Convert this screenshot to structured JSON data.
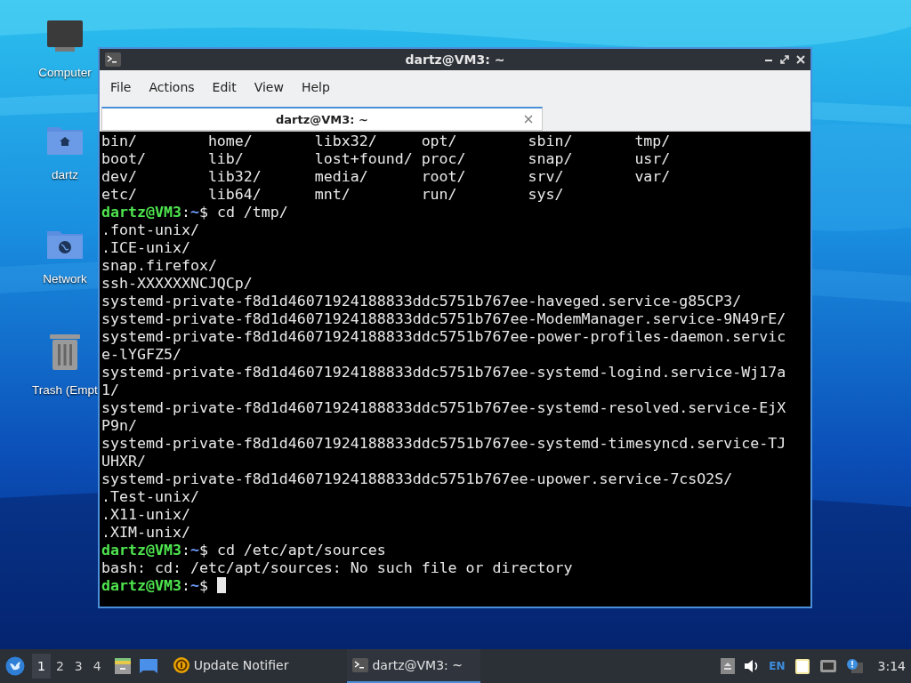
{
  "desktop": {
    "icons": [
      {
        "kind": "computer",
        "label": "Computer"
      },
      {
        "kind": "home",
        "label": "dartz"
      },
      {
        "kind": "network",
        "label": "Network"
      },
      {
        "kind": "trash",
        "label": "Trash (Empt"
      }
    ]
  },
  "window": {
    "title": "dartz@VM3: ~",
    "menu": [
      "File",
      "Actions",
      "Edit",
      "View",
      "Help"
    ],
    "tabs": [
      {
        "label": "dartz@VM3: ~",
        "selected": true
      }
    ],
    "terminal": {
      "lines": [
        {
          "kind": "columns",
          "cells": [
            "bin/",
            "home/",
            "libx32/",
            "opt/",
            "sbin/",
            "tmp/"
          ]
        },
        {
          "kind": "columns",
          "cells": [
            "boot/",
            "lib/",
            "lost+found/",
            "proc/",
            "snap/",
            "usr/"
          ]
        },
        {
          "kind": "columns",
          "cells": [
            "dev/",
            "lib32/",
            "media/",
            "root/",
            "srv/",
            "var/"
          ]
        },
        {
          "kind": "columns",
          "cells": [
            "etc/",
            "lib64/",
            "mnt/",
            "run/",
            "sys/"
          ]
        },
        {
          "kind": "prompt",
          "user": "dartz@VM3",
          "separator": ":",
          "path": "~",
          "command": "$ cd /tmp/",
          "cursor": false
        },
        {
          "kind": "output",
          "text": ".font-unix/"
        },
        {
          "kind": "output",
          "text": ".ICE-unix/"
        },
        {
          "kind": "output",
          "text": "snap.firefox/"
        },
        {
          "kind": "output",
          "text": "ssh-XXXXXXNCJQCp/"
        },
        {
          "kind": "output",
          "text": "systemd-private-f8d1d46071924188833ddc5751b767ee-haveged.service-g85CP3/"
        },
        {
          "kind": "output",
          "text": "systemd-private-f8d1d46071924188833ddc5751b767ee-ModemManager.service-9N49rE/"
        },
        {
          "kind": "output",
          "text": "systemd-private-f8d1d46071924188833ddc5751b767ee-power-profiles-daemon.servic"
        },
        {
          "kind": "output",
          "text": "e-lYGFZ5/"
        },
        {
          "kind": "output",
          "text": "systemd-private-f8d1d46071924188833ddc5751b767ee-systemd-logind.service-Wj17a"
        },
        {
          "kind": "output",
          "text": "1/"
        },
        {
          "kind": "output",
          "text": "systemd-private-f8d1d46071924188833ddc5751b767ee-systemd-resolved.service-EjX"
        },
        {
          "kind": "output",
          "text": "P9n/"
        },
        {
          "kind": "output",
          "text": "systemd-private-f8d1d46071924188833ddc5751b767ee-systemd-timesyncd.service-TJ"
        },
        {
          "kind": "output",
          "text": "UHXR/"
        },
        {
          "kind": "output",
          "text": "systemd-private-f8d1d46071924188833ddc5751b767ee-upower.service-7csO2S/"
        },
        {
          "kind": "output",
          "text": ".Test-unix/"
        },
        {
          "kind": "output",
          "text": ".X11-unix/"
        },
        {
          "kind": "output",
          "text": ".XIM-unix/"
        },
        {
          "kind": "prompt",
          "user": "dartz@VM3",
          "separator": ":",
          "path": "~",
          "command": "$ cd /etc/apt/sources",
          "cursor": false
        },
        {
          "kind": "output",
          "text": "bash: cd: /etc/apt/sources: No such file or directory"
        },
        {
          "kind": "prompt",
          "user": "dartz@VM3",
          "separator": ":",
          "path": "~",
          "command": "$",
          "cursor": true
        }
      ]
    }
  },
  "taskbar": {
    "workspaces": [
      {
        "label": "1",
        "selected": true
      },
      {
        "label": "2",
        "selected": false
      },
      {
        "label": "3",
        "selected": false
      },
      {
        "label": "4",
        "selected": false
      }
    ],
    "tasks": [
      {
        "kind": "notifier",
        "label": "Update Notifier",
        "active": false
      },
      {
        "kind": "terminal",
        "label": "dartz@VM3: ~",
        "active": true
      }
    ],
    "language": "EN",
    "clock": "3:14"
  }
}
